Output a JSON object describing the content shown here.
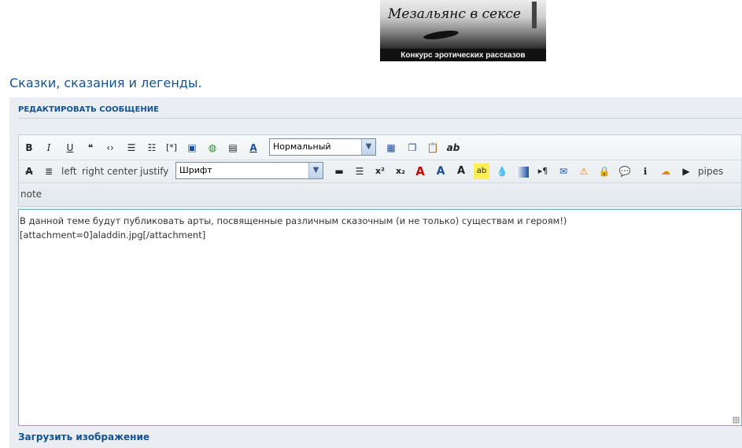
{
  "logo": {
    "title": "Мезальянс в сексе",
    "caption": "Конкурс эротических рассказов"
  },
  "page": {
    "title": "Сказки, сказания и легенды."
  },
  "panel": {
    "header": "РЕДАКТИРОВАТЬ СООБЩЕНИЕ"
  },
  "toolbar": {
    "bold": "B",
    "italic": "I",
    "underline": "U",
    "format_select": "Нормальный",
    "font_select": "Шрифт",
    "left": "left",
    "right": "right",
    "center": "center",
    "justify": "justify",
    "pipes": "pipes",
    "note": "note",
    "ab": "ab",
    "superscript": "x²",
    "subscript": "x₂"
  },
  "editor": {
    "line1": "В данной теме будут публиковать арты, посвященные различным сказочным (и не только) существам и героям!)",
    "line2": "[attachment=0]aladdin.jpg[/attachment]"
  },
  "upload": {
    "label": "Загрузить изображение"
  }
}
